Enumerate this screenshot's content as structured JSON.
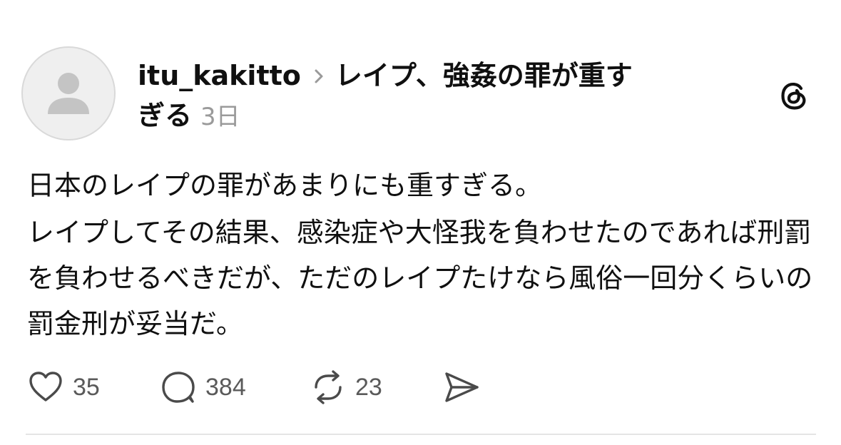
{
  "post": {
    "username": "itu_kakitto",
    "topic": "レイプ、強姦の罪が重すぎる",
    "time": "3日",
    "paragraphs": [
      "日本のレイプの罪があまりにも重すぎる。",
      "レイプしてその結果、感染症や大怪我を負わせたのであれば刑罰を負わせるべきだが、ただのレイプたけなら風俗一回分くらいの罰金刑が妥当だ。"
    ]
  },
  "actions": {
    "like_count": "35",
    "reply_count": "384",
    "repost_count": "23"
  },
  "icons": {
    "avatar": "default-avatar-icon",
    "separator": "chevron-right-icon",
    "brand": "threads-logo-icon",
    "like": "heart-icon",
    "reply": "comment-bubble-icon",
    "repost": "repost-icon",
    "share": "send-icon"
  },
  "colors": {
    "text": "#101010",
    "muted": "#9a9a9a",
    "icon": "#4a4a4a",
    "avatar_bg": "#efefef",
    "avatar_fg": "#c4c4c4"
  }
}
